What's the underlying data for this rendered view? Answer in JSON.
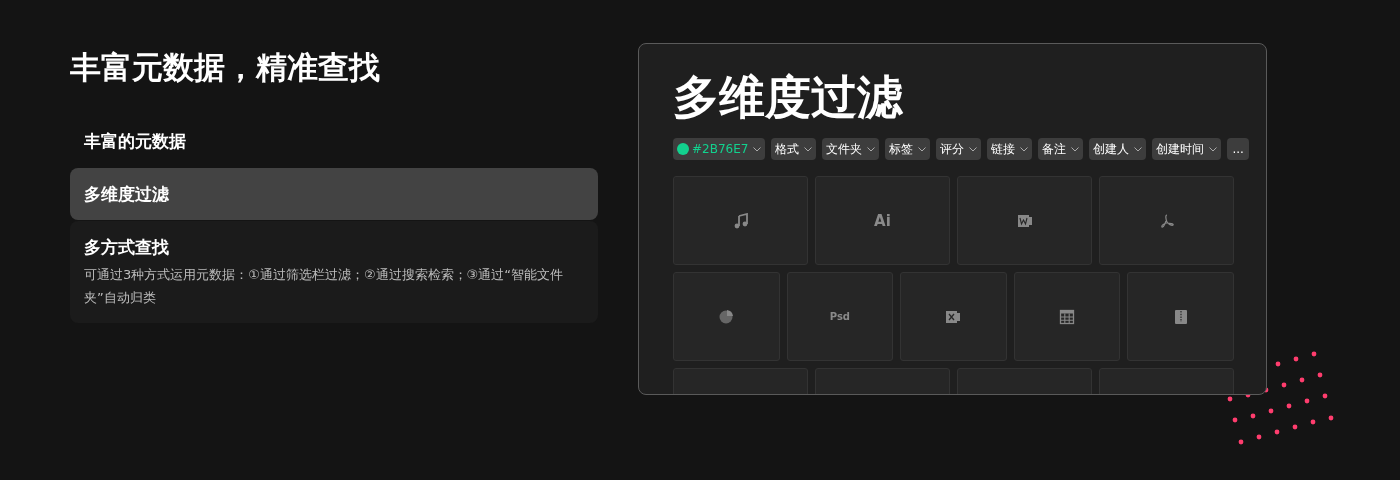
{
  "heading": "丰富元数据，精准查找",
  "sidebar": {
    "items": [
      {
        "title": "丰富的元数据",
        "selected": false
      },
      {
        "title": "多维度过滤",
        "selected": true
      },
      {
        "title": "多方式查找",
        "selected": false,
        "description": "可通过3种方式运用元数据：①通过筛选栏过滤；②通过搜索检索；③通过“智能文件夹”自动归类"
      }
    ]
  },
  "preview": {
    "title": "多维度过滤",
    "filters": [
      {
        "kind": "color",
        "label": "#2B76E7",
        "color": "#12d18e"
      },
      {
        "kind": "dropdown",
        "label": "格式"
      },
      {
        "kind": "dropdown",
        "label": "文件夹"
      },
      {
        "kind": "dropdown",
        "label": "标签"
      },
      {
        "kind": "dropdown",
        "label": "评分"
      },
      {
        "kind": "dropdown",
        "label": "链接"
      },
      {
        "kind": "dropdown",
        "label": "备注"
      },
      {
        "kind": "dropdown",
        "label": "创建人"
      },
      {
        "kind": "dropdown",
        "label": "创建时间"
      },
      {
        "kind": "more",
        "label": "..."
      }
    ],
    "grid_rows": [
      {
        "tiles": [
          {
            "kind": "music"
          },
          {
            "kind": "text",
            "label": "Ai"
          },
          {
            "kind": "word"
          },
          {
            "kind": "pdf"
          }
        ]
      },
      {
        "tiles": [
          {
            "kind": "pie"
          },
          {
            "kind": "text",
            "label": "Psd"
          },
          {
            "kind": "excel"
          },
          {
            "kind": "table"
          },
          {
            "kind": "zip"
          }
        ]
      },
      {
        "tiles": [
          {
            "kind": "empty"
          },
          {
            "kind": "empty"
          },
          {
            "kind": "empty"
          },
          {
            "kind": "empty"
          }
        ]
      }
    ]
  }
}
